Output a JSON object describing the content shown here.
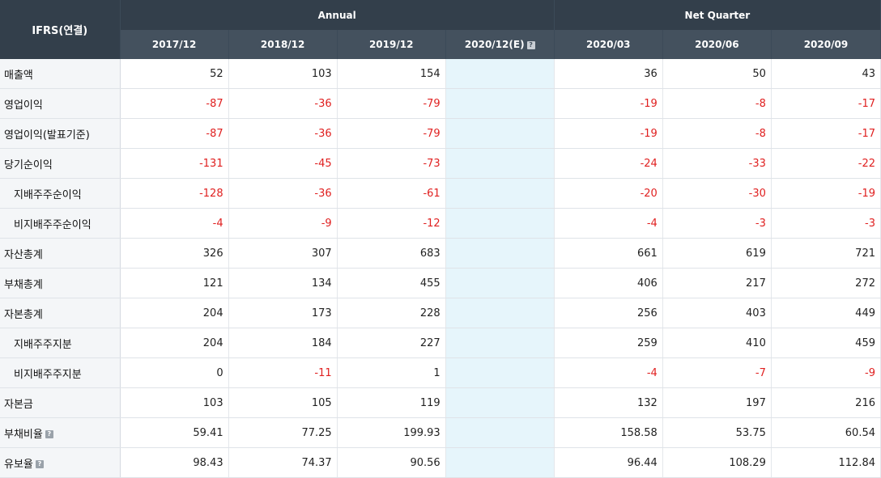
{
  "table": {
    "corner_label": "IFRS(연결)",
    "group_annual": "Annual",
    "group_quarter": "Net Quarter",
    "columns": [
      "2017/12",
      "2018/12",
      "2019/12",
      "2020/12(E)",
      "2020/03",
      "2020/06",
      "2020/09"
    ],
    "estimate_help_icon": "question-icon",
    "rows": [
      {
        "label": "매출액",
        "indent": false,
        "help": false,
        "values": [
          "52",
          "103",
          "154",
          "",
          "36",
          "50",
          "43"
        ]
      },
      {
        "label": "영업이익",
        "indent": false,
        "help": false,
        "values": [
          "-87",
          "-36",
          "-79",
          "",
          "-19",
          "-8",
          "-17"
        ]
      },
      {
        "label": "영업이익(발표기준)",
        "indent": false,
        "help": false,
        "values": [
          "-87",
          "-36",
          "-79",
          "",
          "-19",
          "-8",
          "-17"
        ]
      },
      {
        "label": "당기순이익",
        "indent": false,
        "help": false,
        "values": [
          "-131",
          "-45",
          "-73",
          "",
          "-24",
          "-33",
          "-22"
        ]
      },
      {
        "label": "지배주주순이익",
        "indent": true,
        "help": false,
        "values": [
          "-128",
          "-36",
          "-61",
          "",
          "-20",
          "-30",
          "-19"
        ]
      },
      {
        "label": "비지배주주순이익",
        "indent": true,
        "help": false,
        "values": [
          "-4",
          "-9",
          "-12",
          "",
          "-4",
          "-3",
          "-3"
        ]
      },
      {
        "label": "자산총계",
        "indent": false,
        "help": false,
        "values": [
          "326",
          "307",
          "683",
          "",
          "661",
          "619",
          "721"
        ]
      },
      {
        "label": "부채총계",
        "indent": false,
        "help": false,
        "values": [
          "121",
          "134",
          "455",
          "",
          "406",
          "217",
          "272"
        ]
      },
      {
        "label": "자본총계",
        "indent": false,
        "help": false,
        "values": [
          "204",
          "173",
          "228",
          "",
          "256",
          "403",
          "449"
        ]
      },
      {
        "label": "지배주주지분",
        "indent": true,
        "help": false,
        "values": [
          "204",
          "184",
          "227",
          "",
          "259",
          "410",
          "459"
        ]
      },
      {
        "label": "비지배주주지분",
        "indent": true,
        "help": false,
        "values": [
          "0",
          "-11",
          "1",
          "",
          "-4",
          "-7",
          "-9"
        ]
      },
      {
        "label": "자본금",
        "indent": false,
        "help": false,
        "values": [
          "103",
          "105",
          "119",
          "",
          "132",
          "197",
          "216"
        ]
      },
      {
        "label": "부채비율",
        "indent": false,
        "help": true,
        "values": [
          "59.41",
          "77.25",
          "199.93",
          "",
          "158.58",
          "53.75",
          "60.54"
        ]
      },
      {
        "label": "유보율",
        "indent": false,
        "help": true,
        "values": [
          "98.43",
          "74.37",
          "90.56",
          "",
          "96.44",
          "108.29",
          "112.84"
        ]
      }
    ],
    "colors": {
      "header_dark": "#333f4b",
      "header_mid": "#44515e",
      "negative": "#e02020",
      "estimate_bg": "#e6f5fb",
      "label_bg": "#f4f6f8"
    }
  }
}
